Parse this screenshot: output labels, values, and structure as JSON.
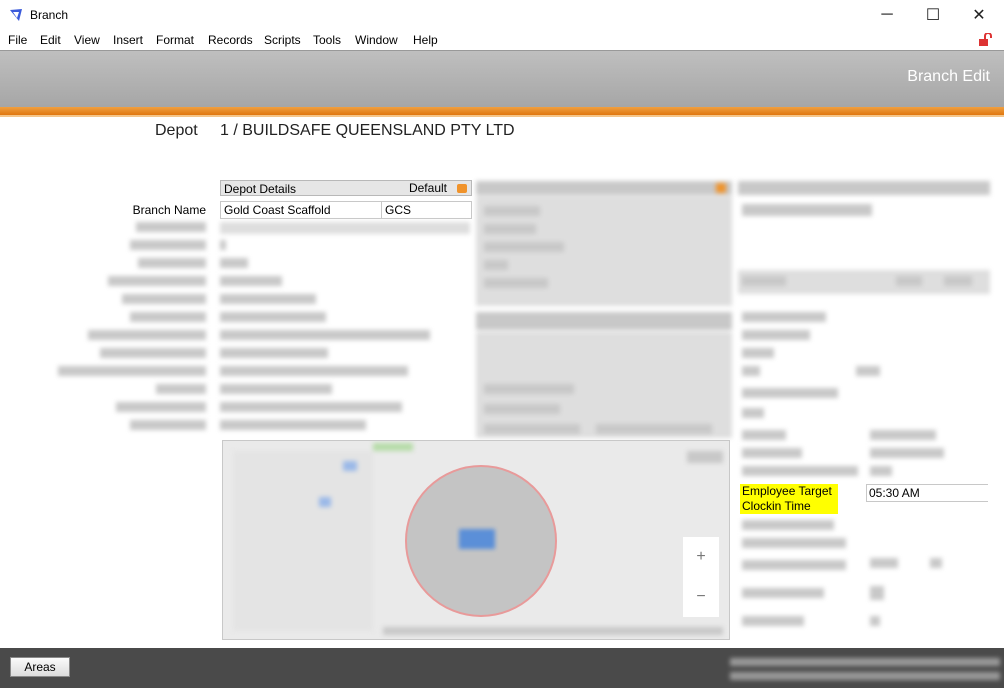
{
  "window": {
    "title": "Branch",
    "minimize_glyph": "─",
    "maximize_glyph": "☐",
    "close_glyph": "✕"
  },
  "menu": [
    "File",
    "Edit",
    "View",
    "Insert",
    "Format",
    "Records",
    "Scripts",
    "Tools",
    "Window",
    "Help"
  ],
  "header": {
    "layout_title": "Branch Edit"
  },
  "depot": {
    "label": "Depot",
    "value": "1 / BUILDSAFE QUEENSLAND PTY LTD"
  },
  "depot_details": {
    "title": "Depot Details",
    "default_label": "Default"
  },
  "branch": {
    "name_label": "Branch Name",
    "name_value": "Gold Coast Scaffold",
    "code_value": "GCS"
  },
  "employee_clockin": {
    "label_line1": "Employee Target",
    "label_line2": "Clockin Time",
    "value": "05:30 AM"
  },
  "map": {
    "zoom_in": "+",
    "zoom_out": "−"
  },
  "footer": {
    "areas_button": "Areas"
  },
  "colors": {
    "accent_orange": "#e8861c",
    "highlight_yellow": "#ffff00",
    "header_gray": "#a6a6a6",
    "footer_dark": "#4a4a4a"
  },
  "icons": {
    "app": "filemaker-icon",
    "lock": "unlock-icon"
  }
}
